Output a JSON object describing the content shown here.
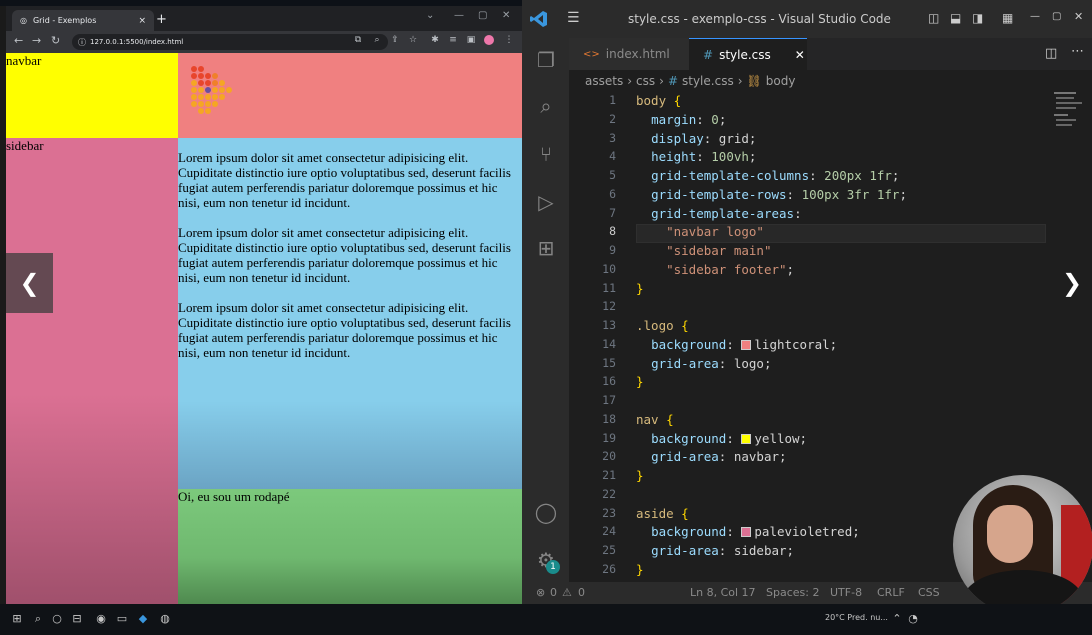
{
  "browser": {
    "tab_title": "Grid - Exemplos",
    "tab_close": "×",
    "new_tab": "+",
    "url": "127.0.0.1:5500/index.html",
    "page": {
      "navbar_text": "navbar",
      "sidebar_text": "sidebar",
      "paragraphs": [
        "Lorem ipsum dolor sit amet consectetur adipisicing elit. Cupiditate distinctio iure optio voluptatibus sed, deserunt facilis fugiat autem perferendis pariatur doloremque possimus et hic nisi, eum non tenetur id incidunt.",
        "Lorem ipsum dolor sit amet consectetur adipisicing elit. Cupiditate distinctio iure optio voluptatibus sed, deserunt facilis fugiat autem perferendis pariatur doloremque possimus et hic nisi, eum non tenetur id incidunt.",
        "Lorem ipsum dolor sit amet consectetur adipisicing elit. Cupiditate distinctio iure optio voluptatibus sed, deserunt facilis fugiat autem perferendis pariatur doloremque possimus et hic nisi, eum non tenetur id incidunt."
      ],
      "footer_text": "Oi, eu sou um rodapé"
    }
  },
  "vscode": {
    "title": "style.css - exemplo-css - Visual Studio Code",
    "tabs": [
      {
        "label": "index.html",
        "icon": "<>"
      },
      {
        "label": "style.css",
        "icon": "#"
      }
    ],
    "tab_close": "✕",
    "breadcrumb": [
      "assets",
      "css",
      "style.css",
      "body"
    ],
    "line_numbers": [
      "1",
      "2",
      "3",
      "4",
      "5",
      "6",
      "7",
      "8",
      "9",
      "10",
      "11",
      "12",
      "13",
      "14",
      "15",
      "16",
      "17",
      "18",
      "19",
      "20",
      "21",
      "22",
      "23",
      "24",
      "25",
      "26"
    ],
    "code_lines": [
      "body {",
      "  margin: 0;",
      "  display: grid;",
      "  height: 100vh;",
      "  grid-template-columns: 200px 1fr;",
      "  grid-template-rows: 100px 3fr 1fr;",
      "  grid-template-areas:",
      "    \"navbar logo\"",
      "    \"sidebar main\"",
      "    \"sidebar footer\";",
      "}",
      "",
      ".logo {",
      "  background: lightcoral;",
      "  grid-area: logo;",
      "}",
      "",
      "nav {",
      "  background: yellow;",
      "  grid-area: navbar;",
      "}",
      "",
      "aside {",
      "  background: palevioletred;",
      "  grid-area: sidebar;",
      "}"
    ],
    "status": {
      "errors": "0",
      "warnings": "0",
      "position": "Ln 8, Col 17",
      "spaces": "Spaces: 2",
      "encoding": "UTF-8",
      "eol": "CRLF",
      "language": "CSS"
    },
    "accounts_badge": "1"
  },
  "taskbar": {
    "weather": "20°C  Pred. nu..."
  },
  "colors": {
    "navbar": "#ffff00",
    "logo": "#f08080",
    "sidebar": "#db7093",
    "main": "#87ceeb",
    "footer": "#7cc97c"
  }
}
